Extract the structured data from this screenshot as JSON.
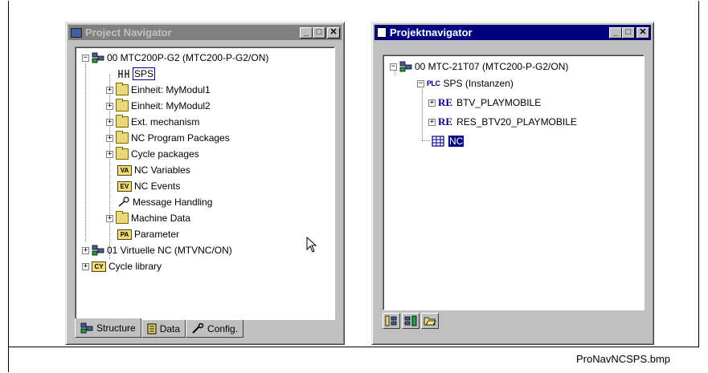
{
  "left_window": {
    "title": "Project Navigator",
    "tree": [
      {
        "label": "00 MTC200P-G2 (MTC200-P-G2/ON)",
        "icon": "plc-icon",
        "expander": "−"
      },
      {
        "label": "SPS",
        "icon": "sps-icon",
        "selected": true
      },
      {
        "label": "Einheit: MyModul1",
        "icon": "folder-icon",
        "expander": "+"
      },
      {
        "label": "Einheit: MyModul2",
        "icon": "folder-icon",
        "expander": "+"
      },
      {
        "label": "Ext. mechanism",
        "icon": "folder-icon",
        "expander": "+"
      },
      {
        "label": "NC Program Packages",
        "icon": "package-folder-icon",
        "expander": "+"
      },
      {
        "label": "Cycle packages",
        "icon": "package-folder-icon",
        "expander": "+"
      },
      {
        "label": "NC Variables",
        "icon": "va-icon",
        "tag": "VA"
      },
      {
        "label": "NC Events",
        "icon": "ev-icon",
        "tag": "EV"
      },
      {
        "label": "Message Handling",
        "icon": "message-icon"
      },
      {
        "label": "Machine Data",
        "icon": "folder-icon",
        "expander": "+"
      },
      {
        "label": "Parameter",
        "icon": "pa-icon",
        "tag": "PA"
      },
      {
        "label": "01 Virtuelle NC (MTVNC/ON)",
        "icon": "plc-icon",
        "expander": "+"
      },
      {
        "label": "Cycle library",
        "icon": "cy-icon",
        "tag": "CY",
        "expander": "+"
      }
    ],
    "tabs": [
      {
        "label": "Structure",
        "icon": "structure-icon"
      },
      {
        "label": "Data",
        "icon": "data-icon"
      },
      {
        "label": "Config.",
        "icon": "wrench-icon"
      }
    ]
  },
  "right_window": {
    "title": "Projektnavigator",
    "tree": [
      {
        "label": "00 MTC-21T07 (MTC200-P-G2/ON)",
        "icon": "plc-icon",
        "expander": "−"
      },
      {
        "label": "SPS (Instanzen)",
        "prefix": "PLC",
        "expander": "−"
      },
      {
        "label": "BTV_PLAYMOBILE",
        "prefix": "RE",
        "expander": "+"
      },
      {
        "label": "RES_BTV20_PLAYMOBILE",
        "prefix": "RE",
        "expander": "+"
      },
      {
        "label": "NC",
        "icon": "nc-table-icon",
        "selected": true
      }
    ],
    "toolbar": [
      "structure-view-icon",
      "data-view-icon",
      "open-folder-icon"
    ]
  },
  "title_buttons": {
    "minimize": "_",
    "maximize": "□",
    "close": "✕"
  },
  "caption": "ProNavNCSPS.bmp",
  "colors": {
    "active_title": "#000080",
    "inactive_title": "#808080",
    "face": "#c0c0c0"
  }
}
